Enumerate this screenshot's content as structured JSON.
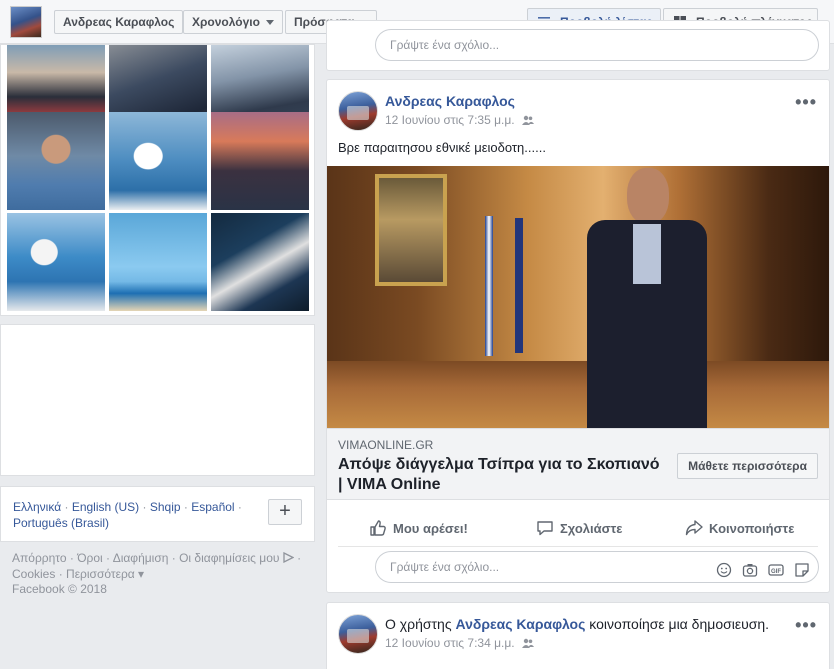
{
  "topbar": {
    "profile_name": "Ανδρεας Καραφλος",
    "timeline_label": "Χρονολόγιο",
    "recent_label": "Πρόσφατα",
    "list_view_label": "Προβολή λίστας",
    "grid_view_label": "Προβολή πλέγματος"
  },
  "languages": {
    "items": [
      "Ελληνικά",
      "English (US)",
      "Shqip",
      "Español",
      "Português (Brasil)"
    ],
    "add_label": "+"
  },
  "footer": {
    "links": [
      "Απόρρητο",
      "Όροι",
      "Διαφήμιση",
      "Οι διαφημίσεις μου",
      "Cookies",
      "Περισσότερα"
    ],
    "copyright": "Facebook © 2018"
  },
  "comment_placeholder": "Γράψτε ένα σχόλιο...",
  "post1": {
    "author": "Ανδρεας Καραφλος",
    "timestamp": "12 Ιουνίου στις 7:35 μ.μ.",
    "text": "Βρε παραιτησου εθνικέ μειοδοτη......",
    "link_domain": "VIMAONLINE.GR",
    "link_title": "Απόψε διάγγελμα Τσίπρα για το Σκοπιανό | VIMA Online",
    "learn_more": "Μάθετε περισσότερα",
    "actions": {
      "like": "Μου αρέσει!",
      "comment": "Σχολιάστε",
      "share": "Κοινοποιήστε"
    }
  },
  "post2": {
    "prefix": "Ο χρήστης",
    "author": "Ανδρεας Καραφλος",
    "suffix": "κοινοποίησε μια δημοσιευση.",
    "timestamp": "12 Ιουνίου στις 7:34 μ.μ."
  }
}
